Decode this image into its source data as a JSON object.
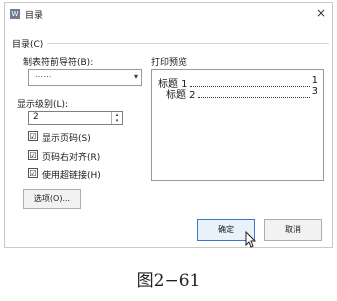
{
  "window": {
    "title": "目录",
    "icon_glyph": "W",
    "close_glyph": "×"
  },
  "group": {
    "label": "目录(C)"
  },
  "tab_leader": {
    "label": "制表符前导符(B):",
    "value": "……",
    "arrow": "▾"
  },
  "levels": {
    "label": "显示级别(L):",
    "value": "2",
    "up": "▴",
    "down": "▾"
  },
  "checkboxes": [
    {
      "label": "显示页码(S)",
      "checked": true
    },
    {
      "label": "页码右对齐(R)",
      "checked": true
    },
    {
      "label": "使用超链接(H)",
      "checked": true
    }
  ],
  "check_glyph": "☑",
  "options_button": "选项(O)...",
  "preview": {
    "label": "打印预览",
    "entries": [
      {
        "text": "标题 1",
        "page": "1"
      },
      {
        "text": "标题 2",
        "page": "3"
      }
    ]
  },
  "buttons": {
    "ok": "确定",
    "cancel": "取消"
  },
  "caption": "图2−61"
}
